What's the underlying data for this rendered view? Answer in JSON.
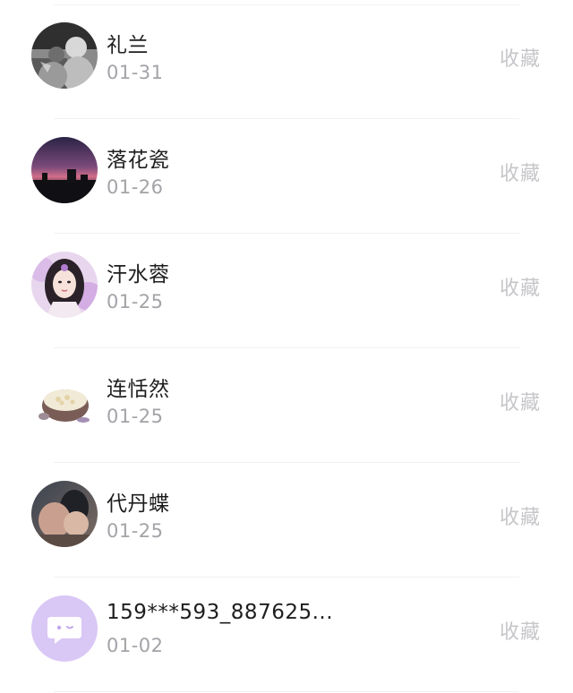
{
  "contacts": [
    {
      "name": "礼兰",
      "date": "01-31",
      "action_label": "收藏",
      "avatar_icon": "grayscale-couple-photo"
    },
    {
      "name": "落花瓷",
      "date": "01-26",
      "action_label": "收藏",
      "avatar_icon": "sunset-sky-photo"
    },
    {
      "name": "汗水蓉",
      "date": "01-25",
      "action_label": "收藏",
      "avatar_icon": "costume-girl-portrait"
    },
    {
      "name": "连恬然",
      "date": "01-25",
      "action_label": "收藏",
      "avatar_icon": "dessert-bowl-photo"
    },
    {
      "name": "代丹蝶",
      "date": "01-25",
      "action_label": "收藏",
      "avatar_icon": "couple-photo"
    },
    {
      "name": "159***593_887625...",
      "date": "01-02",
      "action_label": "收藏",
      "avatar_icon": "default-chat-bubble-avatar"
    }
  ],
  "colors": {
    "name_text": "#1e1e1e",
    "date_text": "#a3a3a8",
    "action_text": "#c6c6ca",
    "default_avatar_bg": "#d9c7f5"
  }
}
